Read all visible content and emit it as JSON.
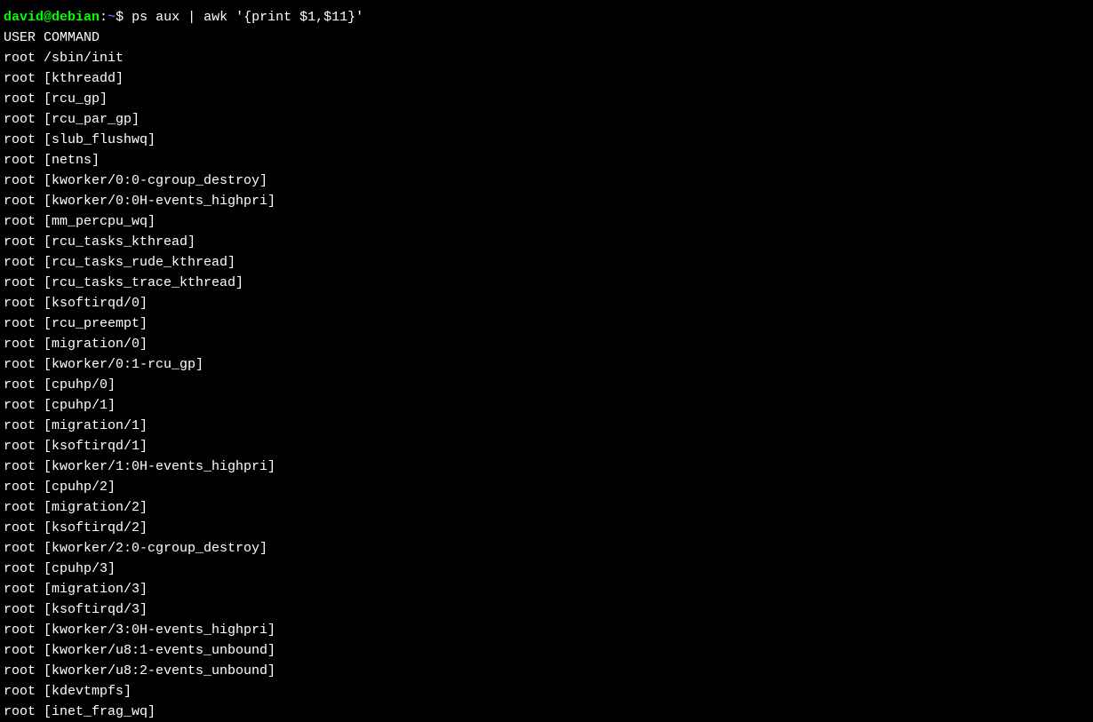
{
  "prompt": {
    "user": "david",
    "at": "@",
    "host": "debian",
    "colon": ":",
    "path": "~",
    "dollar": "$ "
  },
  "command": "ps aux | awk '{print $1,$11}'",
  "header": "USER COMMAND",
  "output": [
    "root /sbin/init",
    "root [kthreadd]",
    "root [rcu_gp]",
    "root [rcu_par_gp]",
    "root [slub_flushwq]",
    "root [netns]",
    "root [kworker/0:0-cgroup_destroy]",
    "root [kworker/0:0H-events_highpri]",
    "root [mm_percpu_wq]",
    "root [rcu_tasks_kthread]",
    "root [rcu_tasks_rude_kthread]",
    "root [rcu_tasks_trace_kthread]",
    "root [ksoftirqd/0]",
    "root [rcu_preempt]",
    "root [migration/0]",
    "root [kworker/0:1-rcu_gp]",
    "root [cpuhp/0]",
    "root [cpuhp/1]",
    "root [migration/1]",
    "root [ksoftirqd/1]",
    "root [kworker/1:0H-events_highpri]",
    "root [cpuhp/2]",
    "root [migration/2]",
    "root [ksoftirqd/2]",
    "root [kworker/2:0-cgroup_destroy]",
    "root [cpuhp/3]",
    "root [migration/3]",
    "root [ksoftirqd/3]",
    "root [kworker/3:0H-events_highpri]",
    "root [kworker/u8:1-events_unbound]",
    "root [kworker/u8:2-events_unbound]",
    "root [kdevtmpfs]",
    "root [inet_frag_wq]"
  ]
}
